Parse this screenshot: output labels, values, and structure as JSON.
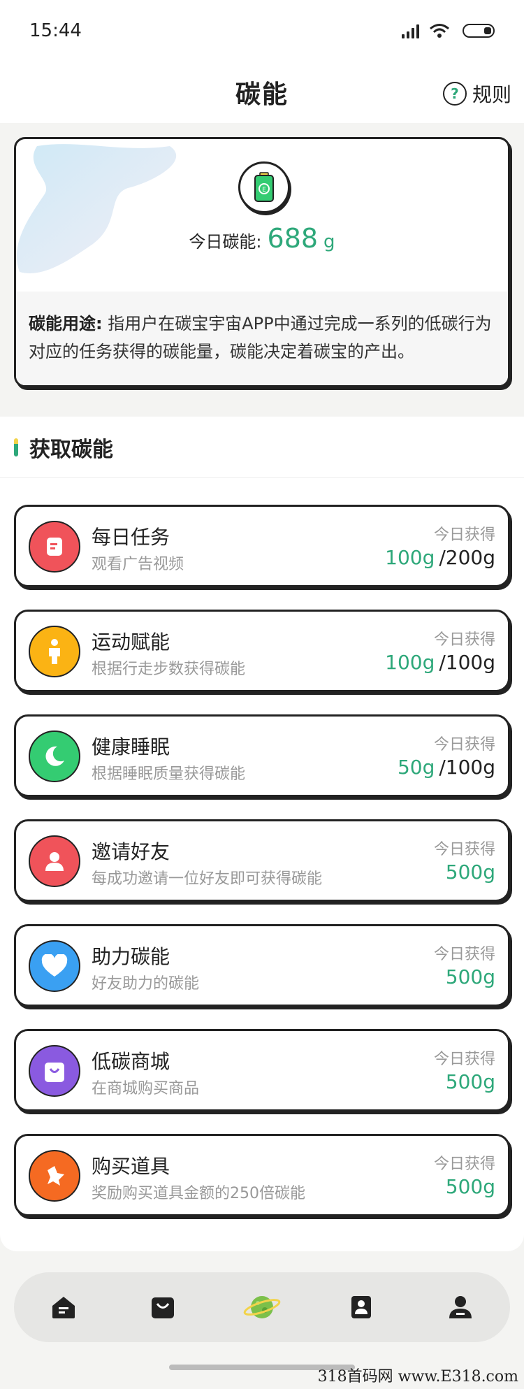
{
  "status_bar": {
    "time": "15:44"
  },
  "header": {
    "title": "碳能",
    "rules_label": "规则",
    "help_icon": "question-circle-icon"
  },
  "energy_card": {
    "icon": "battery-energy-icon",
    "today_label": "今日碳能:",
    "today_value": "688",
    "today_unit": "g",
    "usage_title": "碳能用途:",
    "usage_text": "指用户在碳宝宇宙APP中通过完成一系列的低碳行为对应的任务获得的碳能量，碳能决定着碳宝的产出。"
  },
  "section": {
    "title": "获取碳能"
  },
  "tasks": [
    {
      "title": "每日任务",
      "subtitle": "观看广告视频",
      "earned_label": "今日获得",
      "earned": "100g",
      "total": "/200g",
      "icon": "document-icon",
      "color": "#f0535a"
    },
    {
      "title": "运动赋能",
      "subtitle": "根据行走步数获得碳能",
      "earned_label": "今日获得",
      "earned": "100g",
      "total": "/100g",
      "icon": "walking-person-icon",
      "color": "#fbb314"
    },
    {
      "title": "健康睡眠",
      "subtitle": "根据睡眠质量获得碳能",
      "earned_label": "今日获得",
      "earned": "50g",
      "total": "/100g",
      "icon": "moon-icon",
      "color": "#34cc72"
    },
    {
      "title": "邀请好友",
      "subtitle": "每成功邀请一位好友即可获得碳能",
      "earned_label": "今日获得",
      "earned": "500g",
      "total": "",
      "icon": "user-icon",
      "color": "#f0535a"
    },
    {
      "title": "助力碳能",
      "subtitle": "好友助力的碳能",
      "earned_label": "今日获得",
      "earned": "500g",
      "total": "",
      "icon": "heart-icon",
      "color": "#3aa0f2"
    },
    {
      "title": "低碳商城",
      "subtitle": "在商城购买商品",
      "earned_label": "今日获得",
      "earned": "500g",
      "total": "",
      "icon": "shopping-bag-icon",
      "color": "#8a5ae0"
    },
    {
      "title": "购买道具",
      "subtitle": "奖励购买道具金额的250倍碳能",
      "earned_label": "今日获得",
      "earned": "500g",
      "total": "",
      "icon": "tool-icon",
      "color": "#f56a22"
    }
  ],
  "bottom_nav": [
    {
      "icon": "home-icon"
    },
    {
      "icon": "shop-bag-icon"
    },
    {
      "icon": "planet-icon"
    },
    {
      "icon": "contacts-icon"
    },
    {
      "icon": "profile-icon"
    }
  ],
  "watermark": "318首码网 www.E318.com"
}
